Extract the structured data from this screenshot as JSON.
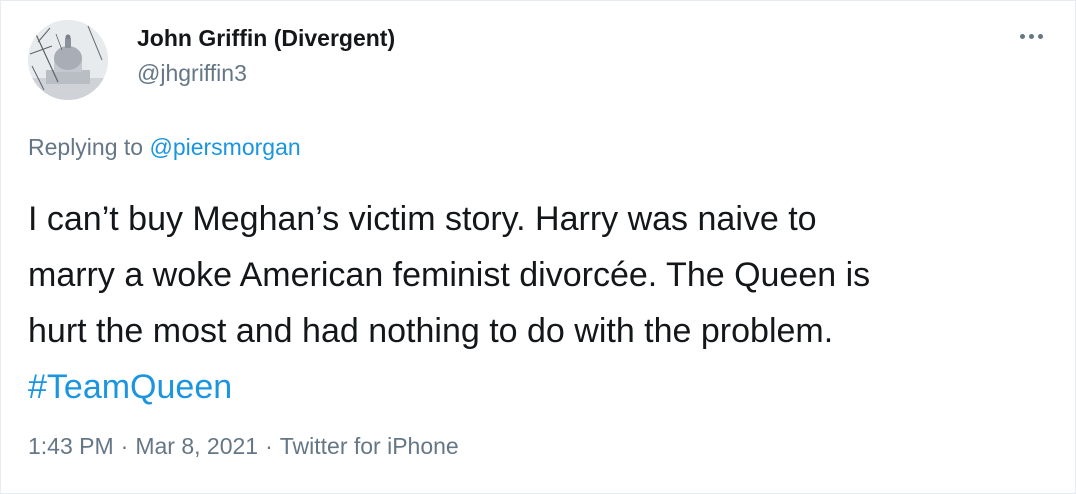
{
  "author": {
    "display_name": "John Griffin (Divergent)",
    "handle": "@jhgriffin3",
    "avatar_icon": "capitol-dome-avatar"
  },
  "more_icon": "more-options-icon",
  "reply": {
    "prefix": "Replying to",
    "mention": "@piersmorgan"
  },
  "tweet": {
    "lines": [
      "I can’t buy Meghan’s victim story.  Harry was naive to",
      "marry a woke American feminist divorcée.  The Queen is",
      "hurt the most and had nothing to do with the problem."
    ],
    "hashtag": "#TeamQueen"
  },
  "meta": {
    "time": "1:43 PM",
    "separator": "·",
    "date": "Mar 8, 2021",
    "source": "Twitter for iPhone"
  },
  "colors": {
    "link": "#1b95e0",
    "secondary": "#657786",
    "primary": "#14171a",
    "border": "#e6ecf0"
  }
}
